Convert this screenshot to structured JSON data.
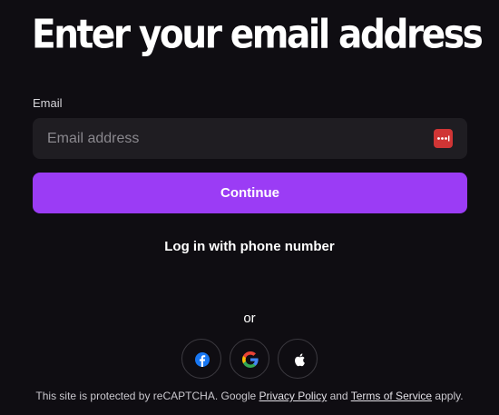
{
  "heading": "Enter your email address",
  "email": {
    "label": "Email",
    "placeholder": "Email address",
    "value": "",
    "autofill_icon": "password-manager-icon"
  },
  "continue_button": "Continue",
  "phone_login_link": "Log in with phone number",
  "divider_text": "or",
  "social_buttons": [
    {
      "icon": "facebook-icon",
      "color": "#1877f2"
    },
    {
      "icon": "google-icon",
      "color": "#4285f4"
    },
    {
      "icon": "apple-icon",
      "color": "#ffffff"
    }
  ],
  "footer": {
    "prefix": "This site is protected by reCAPTCHA. Google",
    "privacy_link": "Privacy Policy",
    "and_text": "and",
    "terms_link": "Terms of Service",
    "suffix": "apply."
  },
  "colors": {
    "background": "#0f0d12",
    "input_background": "#1f1d22",
    "accent": "#9b3cf5",
    "password_icon": "#d03535"
  }
}
